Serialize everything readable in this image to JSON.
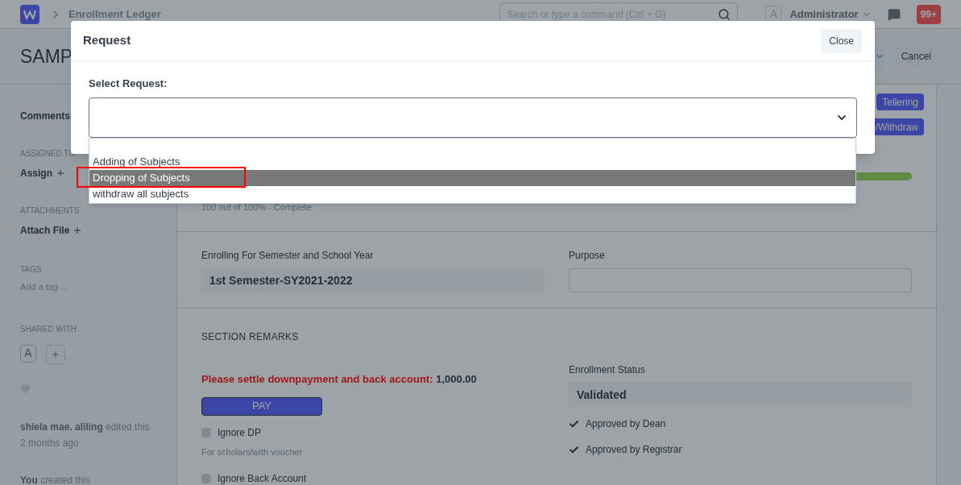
{
  "navbar": {
    "breadcrumb": "Enrollment Ledger",
    "search": {
      "placeholder": "Search or type a command (Ctrl + G)"
    },
    "avatar": "A",
    "user": "Administrator",
    "notifications": "99+"
  },
  "title_bar": {
    "title": "SAMP",
    "cancel": "Cancel"
  },
  "sidebar": {
    "comments": "Comments",
    "assigned_to": {
      "heading": "ASSIGNED TO",
      "action": "Assign"
    },
    "attachments": {
      "heading": "ATTACHMENTS",
      "action": "Attach File"
    },
    "tags": {
      "heading": "TAGS",
      "placeholder": "Add a tag ..."
    },
    "shared_with": {
      "heading": "SHARED WITH",
      "avatar": "A"
    },
    "activity": [
      {
        "who": "shiela mae. aliling",
        "what": "edited this",
        "when": "2 months ago"
      },
      {
        "who": "You",
        "what": "created this"
      }
    ]
  },
  "actions": [
    "Tellering",
    "/Withdraw"
  ],
  "progress": {
    "level": 1.0,
    "caption": "100 out of 100% - Complete"
  },
  "fields": [
    {
      "label": "Enrolling For Semester and School Year",
      "value": "1st Semester-SY2021-2022",
      "kind": "readonly"
    },
    {
      "label": "Purpose",
      "kind": "input"
    }
  ],
  "section_remarks": {
    "heading": "SECTION REMARKS",
    "notice": "Please settle downpayment and back account:",
    "amount": "1,000.00",
    "pay": "PAY",
    "checks": [
      {
        "label": "Ignore DP",
        "checked": false,
        "hint": "For scholars/with voucher"
      },
      {
        "label": "Ignore Back Account",
        "checked": false
      }
    ],
    "status_label": "Enrollment Status",
    "status": "Validated",
    "approvals": [
      {
        "label": "Approved by Dean",
        "checked": true
      },
      {
        "label": "Approved by Registrar",
        "checked": true
      }
    ]
  },
  "request_dialog": {
    "title": "Request",
    "close": "Close",
    "field_label": "Select Request:",
    "options": [
      {
        "label": "Adding of Subjects",
        "selected": false
      },
      {
        "label": "Dropping of Subjects",
        "selected": true
      },
      {
        "label": "withdraw all subjects",
        "selected": false
      }
    ]
  }
}
